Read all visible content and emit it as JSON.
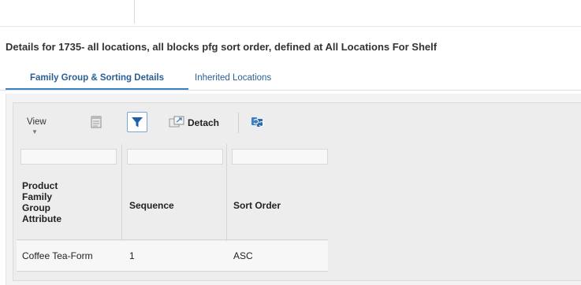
{
  "page": {
    "title": "Details for 1735- all locations, all blocks pfg sort order, defined at All Locations For Shelf"
  },
  "tabs": [
    {
      "label": "Family Group & Sorting Details",
      "active": true
    },
    {
      "label": "Inherited Locations",
      "active": false
    }
  ],
  "toolbar": {
    "view_label": "View",
    "view_caret": "▼",
    "detach_label": "Detach",
    "icons": [
      "export-icon",
      "filter-icon",
      "detach-icon",
      "refresh-icon"
    ]
  },
  "table": {
    "columns": [
      "Product Family Group Attribute",
      "Sequence",
      "Sort Order"
    ],
    "header_lines": [
      "Product",
      "Family",
      "Group",
      "Attribute"
    ],
    "rows": [
      {
        "attribute": "Coffee Tea-Form",
        "sequence": "1",
        "sort_order": "ASC"
      }
    ]
  },
  "colors": {
    "tab_active": "#2a5f96",
    "tab_underline": "#3b82c4",
    "filter_icon": "#1e5fa8"
  }
}
